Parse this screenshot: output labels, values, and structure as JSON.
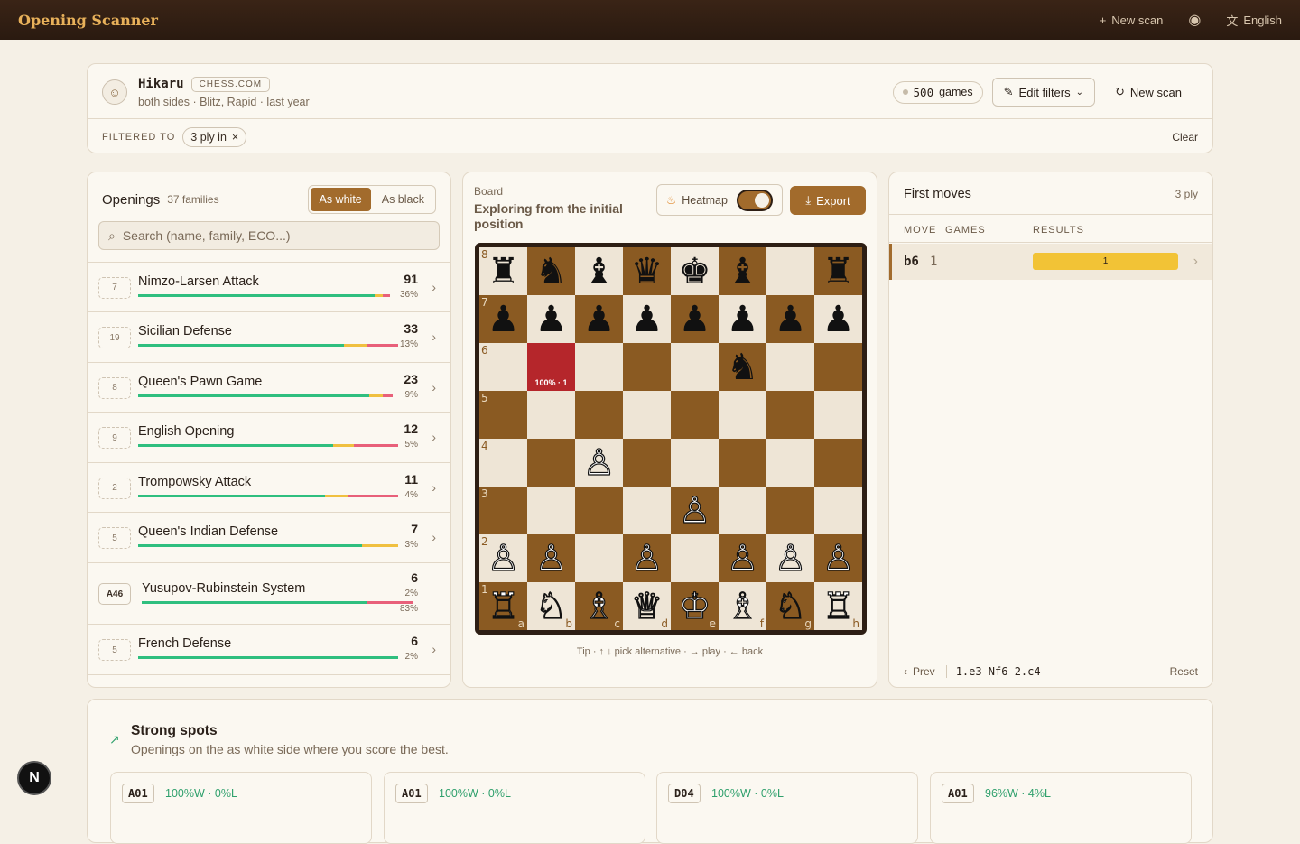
{
  "topbar": {
    "brand": "Opening Scanner",
    "new_scan": "New scan",
    "language": "English"
  },
  "profile": {
    "name": "Hikaru",
    "site": "CHESS.COM",
    "sub": "both sides · Blitz, Rapid · last year",
    "games_count": "500",
    "games_label": "games",
    "edit_filters": "Edit filters",
    "new_scan": "New scan",
    "filtered_to": "FILTERED TO",
    "filter_chip": "3 ply in",
    "clear": "Clear"
  },
  "openings": {
    "title": "Openings",
    "families": "37 families",
    "tab_white": "As white",
    "tab_black": "As black",
    "search_placeholder": "Search (name, family, ECO...)",
    "items": [
      {
        "eco": "7",
        "name": "Nimzo-Larsen Attack",
        "count": "91",
        "pct": "36%",
        "win": 0.91,
        "draw": 0.03,
        "loss": 0.03
      },
      {
        "eco": "19",
        "name": "Sicilian Defense",
        "count": "33",
        "pct": "13%",
        "win": 0.79,
        "draw": 0.09,
        "loss": 0.12
      },
      {
        "eco": "8",
        "name": "Queen's Pawn Game",
        "count": "23",
        "pct": "9%",
        "win": 0.89,
        "draw": 0.05,
        "loss": 0.04
      },
      {
        "eco": "9",
        "name": "English Opening",
        "count": "12",
        "pct": "5%",
        "win": 0.75,
        "draw": 0.08,
        "loss": 0.17
      },
      {
        "eco": "2",
        "name": "Trompowsky Attack",
        "count": "11",
        "pct": "4%",
        "win": 0.72,
        "draw": 0.09,
        "loss": 0.19
      },
      {
        "eco": "5",
        "name": "Queen's Indian Defense",
        "count": "7",
        "pct": "3%",
        "win": 0.86,
        "draw": 0.14,
        "loss": 0
      },
      {
        "eco": "A46",
        "name": "Yusupov-Rubinstein System",
        "count": "6",
        "pct": "2%",
        "pct2": "83%",
        "win": 0.83,
        "draw": 0,
        "loss": 0.17
      },
      {
        "eco": "5",
        "name": "French Defense",
        "count": "6",
        "pct": "2%",
        "win": 1,
        "draw": 0,
        "loss": 0
      }
    ]
  },
  "board": {
    "label": "Board",
    "title": "Exploring from the initial position",
    "heatmap": "Heatmap",
    "export": "Export",
    "hot_label": "100% · 1",
    "tip": "Tip · ↑ ↓ pick alternative · → play · ← back",
    "position": [
      [
        "♜",
        "♞",
        "♝",
        "♛",
        "♚",
        "♝",
        "",
        "♜"
      ],
      [
        "♟",
        "♟",
        "♟",
        "♟",
        "♟",
        "♟",
        "♟",
        "♟"
      ],
      [
        "",
        "",
        "",
        "",
        "",
        "♞",
        "",
        ""
      ],
      [
        "",
        "",
        "",
        "",
        "",
        "",
        "",
        ""
      ],
      [
        "",
        "",
        "♙",
        "",
        "",
        "",
        "",
        ""
      ],
      [
        "",
        "",
        "",
        "",
        "♙",
        "",
        "",
        ""
      ],
      [
        "♙",
        "♙",
        "",
        "♙",
        "",
        "♙",
        "♙",
        "♙"
      ],
      [
        "♖",
        "♘",
        "♗",
        "♕",
        "♔",
        "♗",
        "♘",
        "♖"
      ]
    ],
    "ranks": [
      "8",
      "7",
      "6",
      "5",
      "4",
      "3",
      "2",
      "1"
    ],
    "files": [
      "a",
      "b",
      "c",
      "d",
      "e",
      "f",
      "g",
      "h"
    ]
  },
  "moves": {
    "title": "First moves",
    "ply": "3 ply",
    "col_move": "MOVE",
    "col_games": "GAMES",
    "col_results": "RESULTS",
    "rows": [
      {
        "move": "b6",
        "games": "1",
        "result": "1"
      }
    ],
    "prev": "Prev",
    "line": "1.e3 Nf6 2.c4",
    "reset": "Reset"
  },
  "summary": {
    "title": "Strong spots",
    "sub": "Openings on the as white side where you score the best.",
    "cards": [
      {
        "code": "A01",
        "result": "100%W · 0%L"
      },
      {
        "code": "A01",
        "result": "100%W · 0%L"
      },
      {
        "code": "D04",
        "result": "100%W · 0%L"
      },
      {
        "code": "A01",
        "result": "96%W · 4%L"
      }
    ]
  },
  "colors": {
    "accent": "#a26b2c",
    "win": "#2fbf7f",
    "draw": "#f0c040",
    "loss": "#e8607a"
  }
}
